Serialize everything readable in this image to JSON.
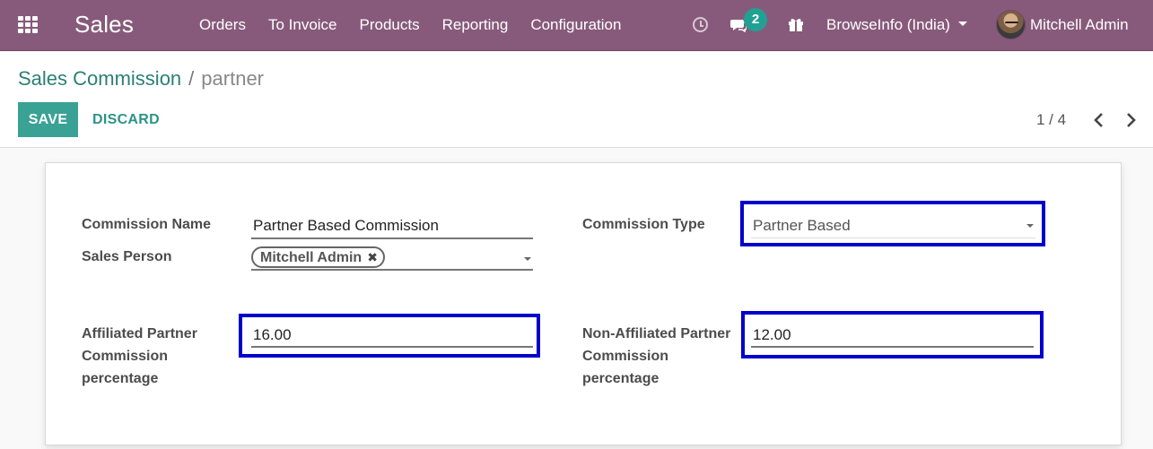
{
  "navbar": {
    "brand": "Sales",
    "menu": [
      "Orders",
      "To Invoice",
      "Products",
      "Reporting",
      "Configuration"
    ],
    "messages_count": "2",
    "company": "BrowseInfo (India)",
    "user": "Mitchell Admin",
    "color": "#875a7b"
  },
  "breadcrumb": {
    "parent": "Sales Commission",
    "separator": "/",
    "current": "partner"
  },
  "actions": {
    "save": "SAVE",
    "discard": "DISCARD"
  },
  "pager": {
    "value": "1 / 4"
  },
  "form": {
    "commission_name_label": "Commission Name",
    "commission_name_value": "Partner Based Commission",
    "sales_person_label": "Sales Person",
    "sales_person_tag": "Mitchell Admin",
    "commission_type_label": "Commission Type",
    "commission_type_value": "Partner Based",
    "affiliated_label_1": "Affiliated Partner",
    "affiliated_label_2": "Commission",
    "affiliated_label_3": "percentage",
    "affiliated_value": "16.00",
    "non_affiliated_label_1": "Non-Affiliated Partner",
    "non_affiliated_label_2": "Commission",
    "non_affiliated_label_3": "percentage",
    "non_affiliated_value": "12.00"
  },
  "colors": {
    "accent": "#3aa195",
    "highlight": "#0000cc"
  }
}
